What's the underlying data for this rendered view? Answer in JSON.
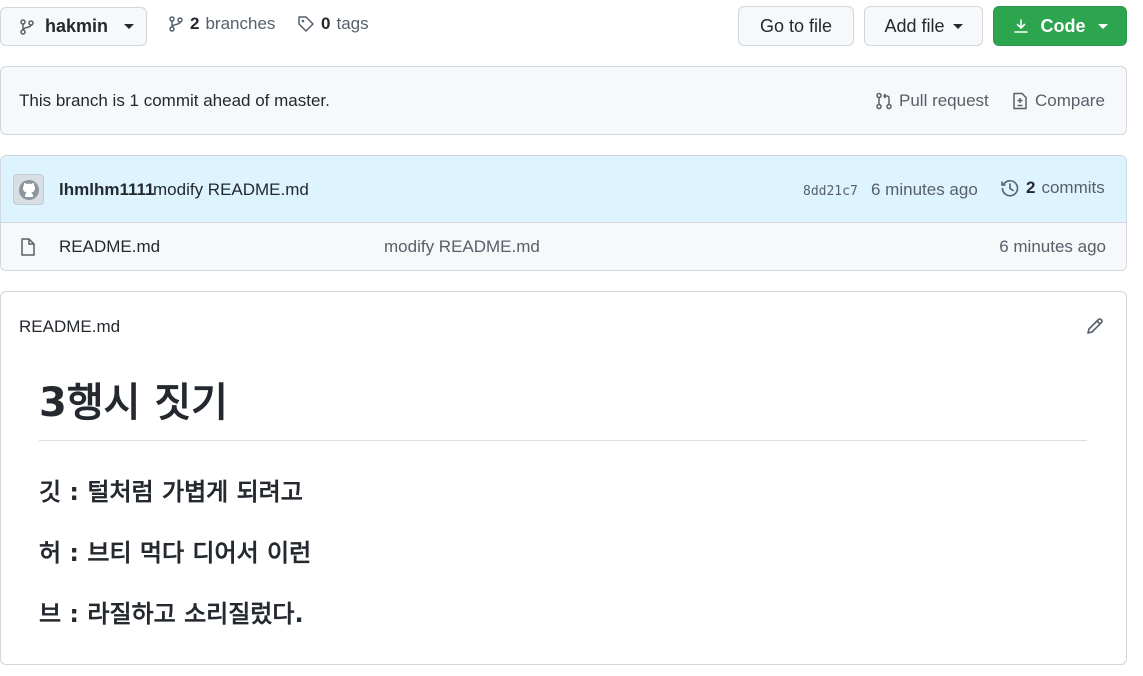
{
  "toolbar": {
    "branch_label": "hakmin",
    "branches_count": "2",
    "branches_label": "branches",
    "tags_count": "0",
    "tags_label": "tags",
    "go_to_file_label": "Go to file",
    "add_file_label": "Add file",
    "code_label": "Code"
  },
  "ahead_banner": {
    "text": "This branch is 1 commit ahead of master.",
    "pull_request_label": "Pull request",
    "compare_label": "Compare"
  },
  "latest_commit": {
    "author": "lhmlhm1111",
    "message": "modify README.md",
    "sha": "8dd21c7",
    "time": "6 minutes ago",
    "commits_count": "2",
    "commits_label": "commits"
  },
  "files": [
    {
      "name": "README.md",
      "message": "modify README.md",
      "time": "6 minutes ago"
    }
  ],
  "readme": {
    "title": "README.md",
    "heading": "3행시 짓기",
    "lines": [
      "깃 : 털처럼 가볍게 되려고",
      "허 : 브티 먹다 디어서 이런",
      "브 : 라질하고 소리질렀다."
    ]
  },
  "colors": {
    "code_button": "#2da44e",
    "commit_row_bg": "#ddf4ff",
    "border": "#d0d7de"
  }
}
